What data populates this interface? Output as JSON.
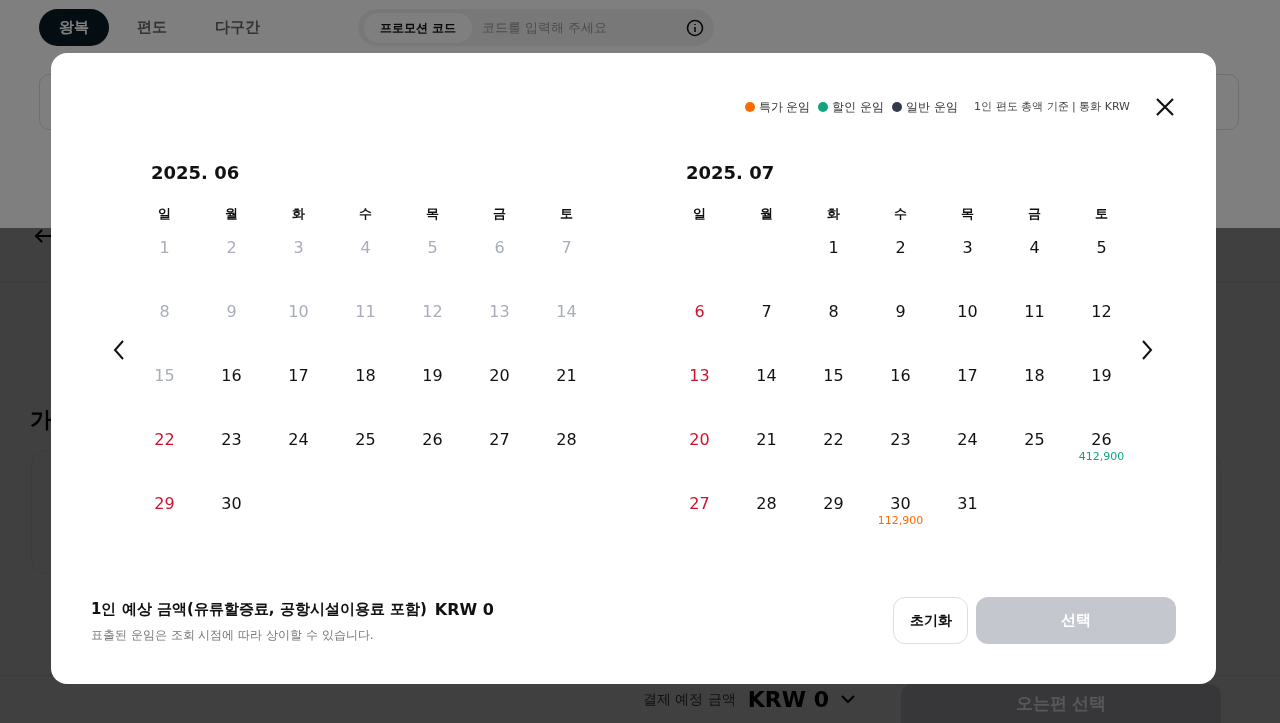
{
  "background": {
    "trip_tabs": [
      {
        "label": "왕복",
        "selected": true
      },
      {
        "label": "편도",
        "selected": false
      },
      {
        "label": "다구간",
        "selected": false
      }
    ],
    "promo": {
      "label": "프로모션 코드",
      "placeholder": "코드를 입력해 주세요"
    },
    "section_heading": "가",
    "payment": {
      "label": "결제 예정 금액",
      "amount": "KRW 0",
      "button": "오는편 선택"
    }
  },
  "modal": {
    "legend": [
      {
        "label": "특가 운임",
        "color": "#ff6a00"
      },
      {
        "label": "할인 운임",
        "color": "#10a37f"
      },
      {
        "label": "일반 운임",
        "color": "#333a4a"
      }
    ],
    "basis": "1인 편도 총액 기준 | 통화 KRW",
    "months": [
      {
        "title": "2025. 06",
        "weekdays": [
          "일",
          "월",
          "화",
          "수",
          "목",
          "금",
          "토"
        ],
        "weeks": [
          [
            {
              "day": "1",
              "disabled": true
            },
            {
              "day": "2",
              "disabled": true
            },
            {
              "day": "3",
              "disabled": true
            },
            {
              "day": "4",
              "disabled": true
            },
            {
              "day": "5",
              "disabled": true
            },
            {
              "day": "6",
              "disabled": true
            },
            {
              "day": "7",
              "disabled": true
            }
          ],
          [
            {
              "day": "8",
              "disabled": true
            },
            {
              "day": "9",
              "disabled": true
            },
            {
              "day": "10",
              "disabled": true
            },
            {
              "day": "11",
              "disabled": true
            },
            {
              "day": "12",
              "disabled": true
            },
            {
              "day": "13",
              "disabled": true
            },
            {
              "day": "14",
              "disabled": true
            }
          ],
          [
            {
              "day": "15",
              "disabled": true
            },
            {
              "day": "16",
              "disabled": false
            },
            {
              "day": "17",
              "disabled": false
            },
            {
              "day": "18",
              "disabled": false
            },
            {
              "day": "19",
              "disabled": false
            },
            {
              "day": "20",
              "disabled": false
            },
            {
              "day": "21",
              "disabled": false
            }
          ],
          [
            {
              "day": "22",
              "disabled": false
            },
            {
              "day": "23",
              "disabled": false
            },
            {
              "day": "24",
              "disabled": false
            },
            {
              "day": "25",
              "disabled": false
            },
            {
              "day": "26",
              "disabled": false
            },
            {
              "day": "27",
              "disabled": false
            },
            {
              "day": "28",
              "disabled": false
            }
          ],
          {
            "kind": "closing",
            "days": [
              {
                "day": "29",
                "disabled": false
              },
              {
                "day": "30",
                "disabled": false
              }
            ]
          }
        ]
      },
      {
        "title": "2025. 07",
        "weekdays": [
          "일",
          "월",
          "화",
          "수",
          "목",
          "금",
          "토"
        ],
        "weeks": [
          {
            "kind": "opening",
            "days": [
              {
                "day": "1",
                "disabled": false
              },
              {
                "day": "2",
                "disabled": false
              },
              {
                "day": "3",
                "disabled": false
              },
              {
                "day": "4",
                "disabled": false
              },
              {
                "day": "5",
                "disabled": false
              }
            ]
          },
          [
            {
              "day": "6",
              "disabled": false
            },
            {
              "day": "7",
              "disabled": false
            },
            {
              "day": "8",
              "disabled": false
            },
            {
              "day": "9",
              "disabled": false
            },
            {
              "day": "10",
              "disabled": false
            },
            {
              "day": "11",
              "disabled": false
            },
            {
              "day": "12",
              "disabled": false
            }
          ],
          [
            {
              "day": "13",
              "disabled": false
            },
            {
              "day": "14",
              "disabled": false
            },
            {
              "day": "15",
              "disabled": false
            },
            {
              "day": "16",
              "disabled": false
            },
            {
              "day": "17",
              "disabled": false
            },
            {
              "day": "18",
              "disabled": false
            },
            {
              "day": "19",
              "disabled": false
            }
          ],
          [
            {
              "day": "20",
              "disabled": false
            },
            {
              "day": "21",
              "disabled": false
            },
            {
              "day": "22",
              "disabled": false
            },
            {
              "day": "23",
              "disabled": false
            },
            {
              "day": "24",
              "disabled": false
            },
            {
              "day": "25",
              "disabled": false
            },
            {
              "day": "26",
              "disabled": false,
              "price": "412,900",
              "color": "#10a37f"
            }
          ],
          {
            "kind": "closing",
            "days": [
              {
                "day": "27",
                "disabled": false
              },
              {
                "day": "28",
                "disabled": false
              },
              {
                "day": "29",
                "disabled": false
              },
              {
                "day": "30",
                "disabled": false,
                "price": "112,900",
                "color": "#ff6a00"
              },
              {
                "day": "31",
                "disabled": false
              }
            ]
          }
        ]
      }
    ],
    "summary": {
      "label": "1인 예상 금액(유류할증료, 공항시설이용료 포함)",
      "amount": "KRW 0",
      "note": "표출된 운임은 조회 시점에 따라 상이할 수 있습니다."
    },
    "reset_button": "초기화",
    "select_button": {
      "label": "선택",
      "disabled": true
    }
  }
}
